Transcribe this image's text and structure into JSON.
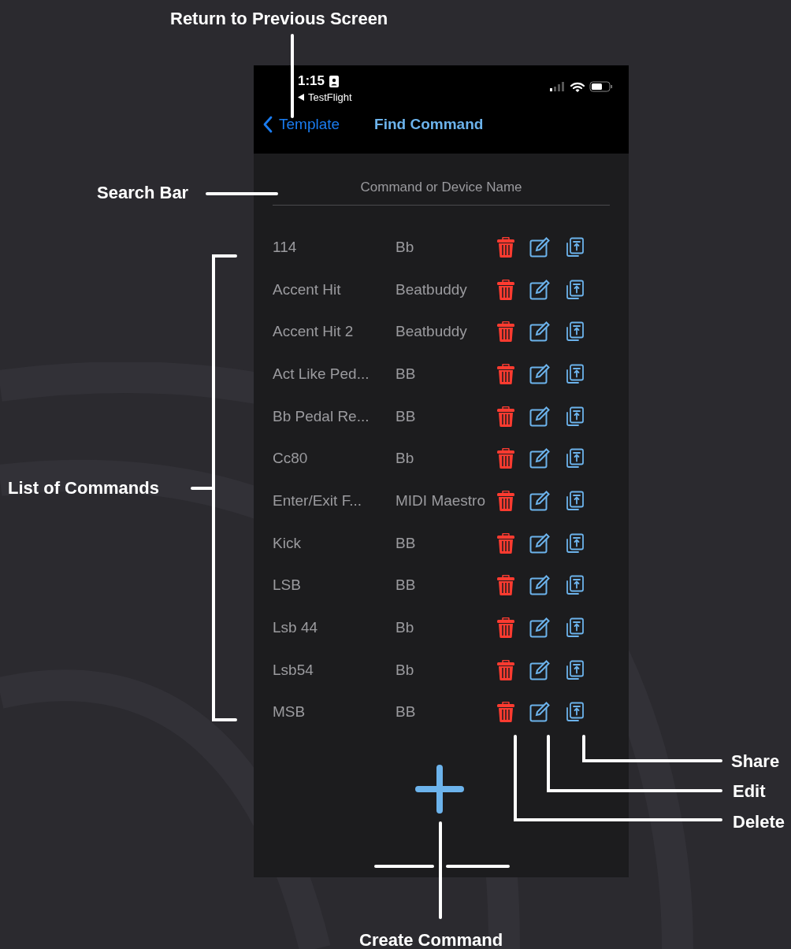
{
  "status_bar": {
    "time": "1:15",
    "back_app": "TestFlight"
  },
  "nav": {
    "back": "Template",
    "title": "Find Command"
  },
  "search": {
    "placeholder": "Command or Device Name"
  },
  "commands": [
    {
      "name": "114",
      "device": "Bb"
    },
    {
      "name": "Accent Hit",
      "device": "Beatbuddy"
    },
    {
      "name": "Accent Hit 2",
      "device": "Beatbuddy"
    },
    {
      "name": "Act Like Ped...",
      "device": "BB"
    },
    {
      "name": "Bb Pedal Re...",
      "device": "BB"
    },
    {
      "name": "Cc80",
      "device": "Bb"
    },
    {
      "name": "Enter/Exit F...",
      "device": "MIDI Maestro"
    },
    {
      "name": "Kick",
      "device": "BB"
    },
    {
      "name": "LSB",
      "device": "BB"
    },
    {
      "name": "Lsb 44",
      "device": "Bb"
    },
    {
      "name": "Lsb54",
      "device": "Bb"
    },
    {
      "name": "MSB",
      "device": "BB"
    }
  ],
  "annotations": [
    {
      "kind": "top",
      "label": "Return to Previous Screen"
    },
    {
      "kind": "search",
      "label": "Search Bar"
    },
    {
      "kind": "list",
      "label": "List of Commands"
    },
    {
      "kind": "share",
      "label": "Share"
    },
    {
      "kind": "edit",
      "label": "Edit"
    },
    {
      "kind": "delete",
      "label": "Delete"
    },
    {
      "kind": "create",
      "label": "Create Command"
    }
  ]
}
